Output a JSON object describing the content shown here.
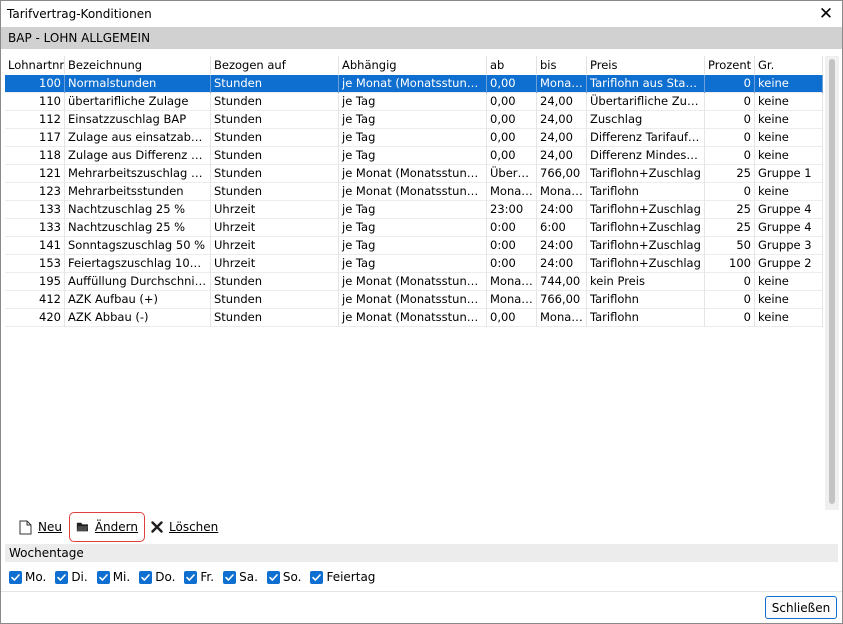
{
  "window": {
    "title": "Tarifvertrag-Konditionen"
  },
  "section_title": "BAP - LOHN ALLGEMEIN",
  "table": {
    "columns": [
      "Lohnartnr.",
      "Bezeichnung",
      "Bezogen auf",
      "Abhängig",
      "ab",
      "bis",
      "Preis",
      "Prozent",
      "Gr."
    ],
    "rows": [
      [
        "100",
        "Normalstunden",
        "Stunden",
        "je Monat (Monatsstunden)",
        "0,00",
        "Monat...",
        "Tariflohn aus Stamm",
        "0",
        "keine"
      ],
      [
        "110",
        "übertarifliche Zulage",
        "Stunden",
        "je Tag",
        "0,00",
        "24,00",
        "Übertarifliche Zulage",
        "0",
        "keine"
      ],
      [
        "112",
        "Einsatzzuschlag BAP",
        "Stunden",
        "je Tag",
        "0,00",
        "24,00",
        "Zuschlag",
        "0",
        "keine"
      ],
      [
        "117",
        "Zulage aus einsatzabh. H...",
        "Stunden",
        "je Tag",
        "0,00",
        "24,00",
        "Differenz Tarifauftra...",
        "0",
        "keine"
      ],
      [
        "118",
        "Zulage aus Differenz Tarif...",
        "Stunden",
        "je Tag",
        "0,00",
        "24,00",
        "Differenz Mindestlo...",
        "0",
        "keine"
      ],
      [
        "121",
        "Mehrarbeitszuschlag 25 %",
        "Stunden",
        "je Monat (Monatsstunden)",
        "Überst...",
        "766,00",
        "Tariflohn+Zuschlag",
        "25",
        "Gruppe 1"
      ],
      [
        "123",
        "Mehrarbeitsstunden",
        "Stunden",
        "je Monat (Monatsstunden)",
        "Monat ...",
        "Monat...",
        "Tariflohn",
        "0",
        "keine"
      ],
      [
        "133",
        "Nachtzuschlag 25 %",
        "Uhrzeit",
        "je Tag",
        "23:00",
        "24:00",
        "Tariflohn+Zuschlag",
        "25",
        "Gruppe 4"
      ],
      [
        "133",
        "Nachtzuschlag 25 %",
        "Uhrzeit",
        "je Tag",
        "0:00",
        "6:00",
        "Tariflohn+Zuschlag",
        "25",
        "Gruppe 4"
      ],
      [
        "141",
        "Sonntagszuschlag 50 %",
        "Uhrzeit",
        "je Tag",
        "0:00",
        "24:00",
        "Tariflohn+Zuschlag",
        "50",
        "Gruppe 3"
      ],
      [
        "153",
        "Feiertagszuschlag 100 %",
        "Uhrzeit",
        "je Tag",
        "0:00",
        "24:00",
        "Tariflohn+Zuschlag",
        "100",
        "Gruppe 2"
      ],
      [
        "195",
        "Auffüllung Durchschnitts...",
        "Stunden",
        "je Monat (Monatsstunden)",
        "Monat ...",
        "744,00",
        "kein Preis",
        "0",
        "keine"
      ],
      [
        "412",
        "AZK Aufbau (+)",
        "Stunden",
        "je Monat (Monatsstunden)",
        "Monat ...",
        "766,00",
        "Tariflohn",
        "0",
        "keine"
      ],
      [
        "420",
        "AZK Abbau (-)",
        "Stunden",
        "je Monat (Monatsstunden)",
        "0,00",
        "Monat...",
        "Tariflohn",
        "0",
        "keine"
      ]
    ],
    "selected_row": 0
  },
  "toolbar": {
    "new_label": "Neu",
    "edit_label": "Ändern",
    "delete_label": "Löschen"
  },
  "weekdays": {
    "title": "Wochentage",
    "days": [
      {
        "label": "Mo.",
        "checked": true
      },
      {
        "label": "Di.",
        "checked": true
      },
      {
        "label": "Mi.",
        "checked": true
      },
      {
        "label": "Do.",
        "checked": true
      },
      {
        "label": "Fr.",
        "checked": true
      },
      {
        "label": "Sa.",
        "checked": true
      },
      {
        "label": "So.",
        "checked": true
      },
      {
        "label": "Feiertag",
        "checked": true
      }
    ]
  },
  "footer": {
    "close_label": "Schließen"
  },
  "colors": {
    "accent": "#0f6fd0",
    "highlight_border": "#e0413d",
    "section_bg": "#d1d1d1"
  },
  "icons": {
    "close": "close-icon",
    "new": "new-document-icon",
    "edit": "folder-icon",
    "delete": "delete-x-icon",
    "checkbox": "checkmark-icon"
  }
}
